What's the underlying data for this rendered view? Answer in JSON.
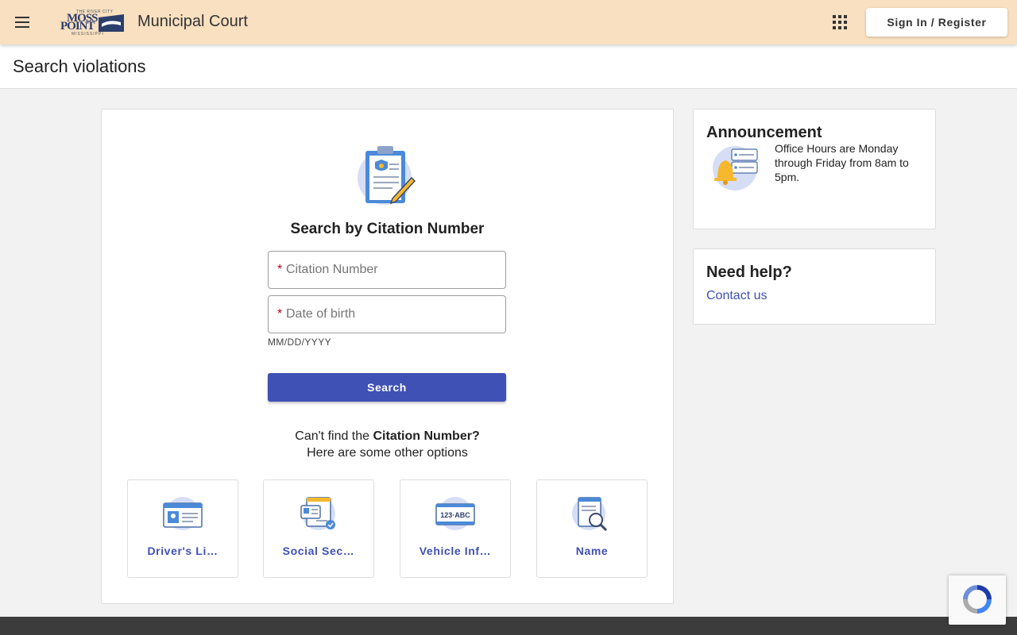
{
  "header": {
    "logo_top": "THE RIVER CITY",
    "logo_line1": "MOSS",
    "logo_line2": "POINT",
    "logo_bottom": "MISSISSIPPI",
    "title": "Municipal Court",
    "signin_label": "Sign In / Register",
    "icons": {
      "menu": "hamburger-menu-icon",
      "apps": "apps-grid-icon"
    }
  },
  "page": {
    "title": "Search violations"
  },
  "search_form": {
    "heading": "Search by Citation Number",
    "citation_placeholder": "Citation Number",
    "dob_placeholder": "Date of birth",
    "required_mark": "*",
    "dob_hint": "MM/DD/YYYY",
    "search_label": "Search",
    "cant_find_prefix": "Can't find the ",
    "cant_find_bold": "Citation Number?",
    "cant_find_line2": "Here are some other options"
  },
  "options": [
    {
      "label": "Driver's Li…",
      "icon": "drivers-license-icon"
    },
    {
      "label": "Social Sec…",
      "icon": "social-security-icon"
    },
    {
      "label": "Vehicle Inf…",
      "icon": "vehicle-plate-icon",
      "plate_text": "123·ABC"
    },
    {
      "label": "Name",
      "icon": "name-search-icon"
    }
  ],
  "announcement": {
    "heading": "Announcement",
    "text": "Office Hours are Monday through Friday from 8am to 5pm."
  },
  "help": {
    "heading": "Need help?",
    "link": "Contact us"
  },
  "colors": {
    "header_bg": "#f8e0c1",
    "primary": "#3f51b5",
    "required": "#b00020",
    "footer": "#3c3c3c"
  }
}
